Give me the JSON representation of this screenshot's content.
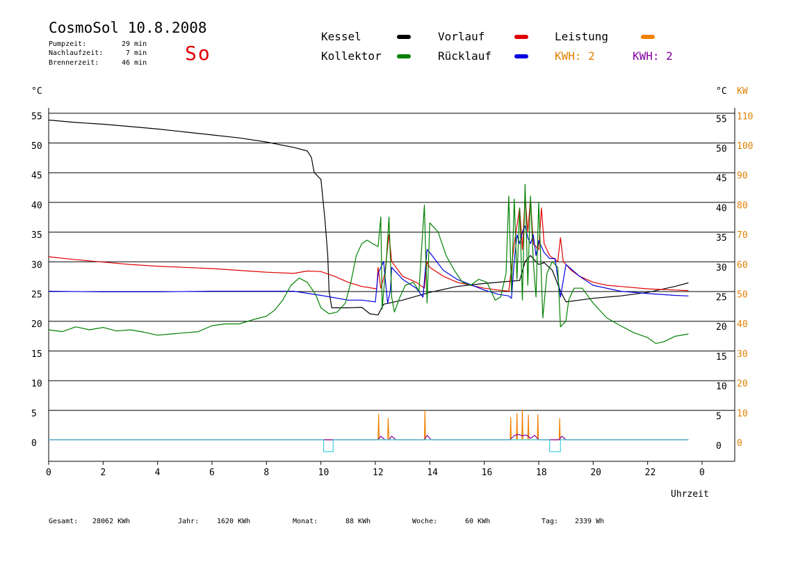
{
  "header": {
    "title": "CosmoSol 10.8.2008",
    "weekday": "So",
    "runtimes": [
      {
        "label": "Pumpzeit:",
        "value": "29 min"
      },
      {
        "label": "Nachlaufzeit:",
        "value": "7 min"
      },
      {
        "label": "Brennerzeit:",
        "value": "46 min"
      }
    ]
  },
  "legend": [
    {
      "name": "Kessel",
      "color": "#000000"
    },
    {
      "name": "Vorlauf",
      "color": "#e00000"
    },
    {
      "name": "Leistung",
      "color": "#f08000"
    },
    {
      "name": "Kollektor",
      "color": "#008000"
    },
    {
      "name": "Rücklauf",
      "color": "#0000e0"
    }
  ],
  "kwh_labels": [
    {
      "text": "KWH: 2",
      "color": "#e08000"
    },
    {
      "text": "KWH: 2",
      "color": "#8000a0"
    }
  ],
  "footer": [
    {
      "label": "Gesamt:",
      "value": "28062 KWh"
    },
    {
      "label": "Jahr:",
      "value": "1620 KWh"
    },
    {
      "label": "Monat:",
      "value": "88 KWh"
    },
    {
      "label": "Woche:",
      "value": "60 KWh"
    },
    {
      "label": "Tag:",
      "value": "2339 Wh"
    }
  ],
  "chart_data": {
    "type": "line",
    "xlabel": "Uhrzeit",
    "ylabel_left": "°C",
    "ylabel_right": "°C",
    "ylabel_right2": "KW",
    "x_ticks": [
      "0",
      "2",
      "4",
      "6",
      "8",
      "10",
      "12",
      "14",
      "16",
      "18",
      "20",
      "22",
      "0"
    ],
    "xlim": [
      0,
      24
    ],
    "ylim": [
      -4,
      56
    ],
    "y_ticks": [
      0,
      5,
      10,
      15,
      20,
      25,
      30,
      35,
      40,
      45,
      50,
      55
    ],
    "kw_ticks": [
      0,
      10,
      20,
      30,
      40,
      50,
      60,
      70,
      80,
      90,
      100,
      110
    ],
    "grid": true,
    "series": [
      {
        "name": "Kessel",
        "color": "#000000",
        "points": [
          [
            0,
            53.8
          ],
          [
            1,
            53.4
          ],
          [
            2,
            53.1
          ],
          [
            3,
            52.7
          ],
          [
            4,
            52.3
          ],
          [
            5,
            51.8
          ],
          [
            6,
            51.3
          ],
          [
            7,
            50.8
          ],
          [
            8,
            50.1
          ],
          [
            9,
            49.2
          ],
          [
            9.5,
            48.6
          ],
          [
            9.65,
            47.5
          ],
          [
            9.75,
            45
          ],
          [
            10,
            43.8
          ],
          [
            10.15,
            37
          ],
          [
            10.25,
            31
          ],
          [
            10.3,
            25
          ],
          [
            10.4,
            22.2
          ],
          [
            11,
            22.2
          ],
          [
            11.5,
            22.3
          ],
          [
            11.8,
            21.2
          ],
          [
            12.1,
            21
          ],
          [
            12.3,
            22.8
          ],
          [
            13,
            23.5
          ],
          [
            14,
            24.8
          ],
          [
            15,
            25.8
          ],
          [
            16,
            26.3
          ],
          [
            17,
            26.7
          ],
          [
            17.3,
            26.8
          ],
          [
            17.5,
            30
          ],
          [
            17.7,
            31
          ],
          [
            18,
            29.5
          ],
          [
            18.2,
            29.8
          ],
          [
            18.5,
            28.5
          ],
          [
            18.8,
            25
          ],
          [
            19,
            23.2
          ],
          [
            19.5,
            23.5
          ],
          [
            20,
            23.8
          ],
          [
            21,
            24.2
          ],
          [
            22,
            24.8
          ],
          [
            23,
            25.8
          ],
          [
            23.5,
            26.4
          ]
        ]
      },
      {
        "name": "Vorlauf",
        "color": "#e00000",
        "points": [
          [
            0,
            30.8
          ],
          [
            1,
            30.3
          ],
          [
            2,
            29.9
          ],
          [
            3,
            29.5
          ],
          [
            4,
            29.2
          ],
          [
            5,
            29.0
          ],
          [
            6,
            28.8
          ],
          [
            7,
            28.5
          ],
          [
            8,
            28.2
          ],
          [
            9,
            28.0
          ],
          [
            9.5,
            28.4
          ],
          [
            10,
            28.3
          ],
          [
            10.5,
            27.5
          ],
          [
            11,
            26.5
          ],
          [
            11.5,
            25.8
          ],
          [
            12.05,
            25.4
          ],
          [
            12.1,
            29
          ],
          [
            12.2,
            25.5
          ],
          [
            12.35,
            28
          ],
          [
            12.5,
            34.5
          ],
          [
            12.6,
            30
          ],
          [
            13,
            27.5
          ],
          [
            13.5,
            26.5
          ],
          [
            13.8,
            25.5
          ],
          [
            13.9,
            30
          ],
          [
            14,
            29
          ],
          [
            14.5,
            27.5
          ],
          [
            15,
            26.5
          ],
          [
            16,
            25.5
          ],
          [
            16.5,
            25.2
          ],
          [
            16.9,
            25
          ],
          [
            17.1,
            33
          ],
          [
            17.2,
            36
          ],
          [
            17.3,
            39
          ],
          [
            17.4,
            32
          ],
          [
            17.5,
            41
          ],
          [
            17.6,
            35
          ],
          [
            17.7,
            40.5
          ],
          [
            17.8,
            33
          ],
          [
            18,
            32
          ],
          [
            18.1,
            39
          ],
          [
            18.2,
            33
          ],
          [
            18.4,
            31
          ],
          [
            18.7,
            30
          ],
          [
            18.8,
            34
          ],
          [
            18.9,
            30
          ],
          [
            19.2,
            28.5
          ],
          [
            19.5,
            27.5
          ],
          [
            20,
            26.5
          ],
          [
            20.5,
            26
          ],
          [
            21,
            25.8
          ],
          [
            22,
            25.4
          ],
          [
            23,
            25.2
          ],
          [
            23.5,
            25.1
          ]
        ]
      },
      {
        "name": "Rücklauf",
        "color": "#0000e0",
        "points": [
          [
            0,
            25
          ],
          [
            2,
            24.9
          ],
          [
            4,
            24.9
          ],
          [
            6,
            25
          ],
          [
            8,
            25
          ],
          [
            9,
            25
          ],
          [
            10,
            24.3
          ],
          [
            11,
            23.5
          ],
          [
            11.5,
            23.5
          ],
          [
            12,
            23.2
          ],
          [
            12.1,
            28
          ],
          [
            12.3,
            30
          ],
          [
            12.45,
            23
          ],
          [
            12.55,
            25
          ],
          [
            12.6,
            29
          ],
          [
            13,
            27
          ],
          [
            13.5,
            25.5
          ],
          [
            13.75,
            24
          ],
          [
            13.9,
            32
          ],
          [
            14,
            31.5
          ],
          [
            14.5,
            28.5
          ],
          [
            15,
            27
          ],
          [
            16,
            25.2
          ],
          [
            16.5,
            24.5
          ],
          [
            16.9,
            24.2
          ],
          [
            17,
            23.8
          ],
          [
            17.1,
            30
          ],
          [
            17.2,
            34.5
          ],
          [
            17.3,
            33
          ],
          [
            17.4,
            35
          ],
          [
            17.5,
            36
          ],
          [
            17.6,
            34
          ],
          [
            17.7,
            33
          ],
          [
            17.8,
            34.5
          ],
          [
            17.9,
            31
          ],
          [
            18,
            33.5
          ],
          [
            18.2,
            31.5
          ],
          [
            18.4,
            30.5
          ],
          [
            18.6,
            30.5
          ],
          [
            18.8,
            24
          ],
          [
            19,
            29.5
          ],
          [
            19.5,
            27.5
          ],
          [
            20,
            26
          ],
          [
            21,
            25
          ],
          [
            22,
            24.6
          ],
          [
            23,
            24.3
          ],
          [
            23.5,
            24.2
          ]
        ]
      },
      {
        "name": "Kollektor",
        "color": "#008000",
        "points": [
          [
            0,
            18.5
          ],
          [
            0.5,
            18.2
          ],
          [
            1,
            19
          ],
          [
            1.5,
            18.5
          ],
          [
            2,
            18.9
          ],
          [
            2.5,
            18.3
          ],
          [
            3,
            18.5
          ],
          [
            3.5,
            18.1
          ],
          [
            4,
            17.6
          ],
          [
            4.5,
            17.8
          ],
          [
            5,
            18
          ],
          [
            5.5,
            18.2
          ],
          [
            6,
            19.2
          ],
          [
            6.5,
            19.5
          ],
          [
            7,
            19.5
          ],
          [
            7.5,
            20.2
          ],
          [
            8,
            20.8
          ],
          [
            8.3,
            21.8
          ],
          [
            8.6,
            23.5
          ],
          [
            8.9,
            26
          ],
          [
            9.2,
            27.2
          ],
          [
            9.5,
            26.5
          ],
          [
            9.8,
            24.5
          ],
          [
            10,
            22.2
          ],
          [
            10.3,
            21.2
          ],
          [
            10.6,
            21.5
          ],
          [
            10.9,
            23
          ],
          [
            11.1,
            26.5
          ],
          [
            11.3,
            31
          ],
          [
            11.5,
            33
          ],
          [
            11.7,
            33.6
          ],
          [
            11.9,
            33
          ],
          [
            12.1,
            32.5
          ],
          [
            12.2,
            37.5
          ],
          [
            12.25,
            22
          ],
          [
            12.4,
            30
          ],
          [
            12.5,
            37.5
          ],
          [
            12.6,
            24
          ],
          [
            12.7,
            21.5
          ],
          [
            12.9,
            24
          ],
          [
            13.1,
            26
          ],
          [
            13.4,
            26.5
          ],
          [
            13.6,
            25
          ],
          [
            13.8,
            39.5
          ],
          [
            13.9,
            23
          ],
          [
            14,
            36.5
          ],
          [
            14.3,
            35
          ],
          [
            14.6,
            31
          ],
          [
            14.9,
            28.5
          ],
          [
            15.2,
            26.5
          ],
          [
            15.5,
            26
          ],
          [
            15.8,
            27
          ],
          [
            16.1,
            26.5
          ],
          [
            16.4,
            23.5
          ],
          [
            16.6,
            24
          ],
          [
            16.8,
            28
          ],
          [
            16.9,
            41
          ],
          [
            17,
            25
          ],
          [
            17.1,
            40.5
          ],
          [
            17.2,
            27
          ],
          [
            17.3,
            39
          ],
          [
            17.4,
            23.5
          ],
          [
            17.5,
            43
          ],
          [
            17.6,
            26
          ],
          [
            17.7,
            41
          ],
          [
            17.8,
            30
          ],
          [
            17.9,
            24
          ],
          [
            18,
            40
          ],
          [
            18.15,
            20.5
          ],
          [
            18.3,
            28
          ],
          [
            18.5,
            30
          ],
          [
            18.7,
            29
          ],
          [
            18.8,
            19
          ],
          [
            19,
            20
          ],
          [
            19.1,
            23.5
          ],
          [
            19.3,
            25.5
          ],
          [
            19.6,
            25.5
          ],
          [
            20,
            23
          ],
          [
            20.5,
            20.5
          ],
          [
            21,
            19.2
          ],
          [
            21.5,
            18
          ],
          [
            22,
            17.2
          ],
          [
            22.3,
            16.2
          ],
          [
            22.6,
            16.5
          ],
          [
            23,
            17.4
          ],
          [
            23.5,
            17.8
          ]
        ]
      },
      {
        "name": "Leistung",
        "color": "#f08000",
        "points": [
          [
            0,
            0
          ],
          [
            12.1,
            0
          ],
          [
            12.12,
            8.6
          ],
          [
            12.14,
            0
          ],
          [
            12.45,
            0
          ],
          [
            12.47,
            7.2
          ],
          [
            12.5,
            0
          ],
          [
            13.8,
            0
          ],
          [
            13.82,
            9.8
          ],
          [
            13.84,
            0
          ],
          [
            16.95,
            0
          ],
          [
            16.97,
            7.5
          ],
          [
            16.99,
            0
          ],
          [
            17.18,
            0
          ],
          [
            17.2,
            8.8
          ],
          [
            17.22,
            0
          ],
          [
            17.38,
            0
          ],
          [
            17.4,
            10
          ],
          [
            17.42,
            0
          ],
          [
            17.6,
            0
          ],
          [
            17.62,
            8.3
          ],
          [
            17.64,
            0
          ],
          [
            17.95,
            0
          ],
          [
            17.97,
            8.5
          ],
          [
            17.99,
            0
          ],
          [
            18.75,
            0
          ],
          [
            18.77,
            7.2
          ],
          [
            18.79,
            0
          ],
          [
            23.5,
            0
          ]
        ]
      },
      {
        "name": "Leistung-avg",
        "color": "#8000a0",
        "points": [
          [
            0,
            0
          ],
          [
            12.1,
            0
          ],
          [
            12.2,
            1.2
          ],
          [
            12.35,
            0
          ],
          [
            12.5,
            0
          ],
          [
            12.6,
            1.2
          ],
          [
            12.75,
            0
          ],
          [
            13.8,
            0
          ],
          [
            13.9,
            1.5
          ],
          [
            14.05,
            0
          ],
          [
            16.95,
            0
          ],
          [
            17.1,
            1.4
          ],
          [
            17.25,
            1.8
          ],
          [
            17.4,
            1.3
          ],
          [
            17.55,
            1.6
          ],
          [
            17.7,
            0.5
          ],
          [
            17.85,
            1.5
          ],
          [
            18,
            0
          ],
          [
            18.75,
            0
          ],
          [
            18.85,
            1.2
          ],
          [
            19,
            0
          ],
          [
            23.5,
            0
          ]
        ]
      },
      {
        "name": "Pumpe",
        "color": "#40d0e0",
        "points": [
          [
            0,
            0
          ],
          [
            10.1,
            0
          ],
          [
            10.1,
            -2
          ],
          [
            10.45,
            -2
          ],
          [
            10.45,
            0
          ],
          [
            18.4,
            0
          ],
          [
            18.4,
            -2
          ],
          [
            18.8,
            -2
          ],
          [
            18.8,
            0
          ],
          [
            23.5,
            0
          ]
        ]
      }
    ]
  }
}
